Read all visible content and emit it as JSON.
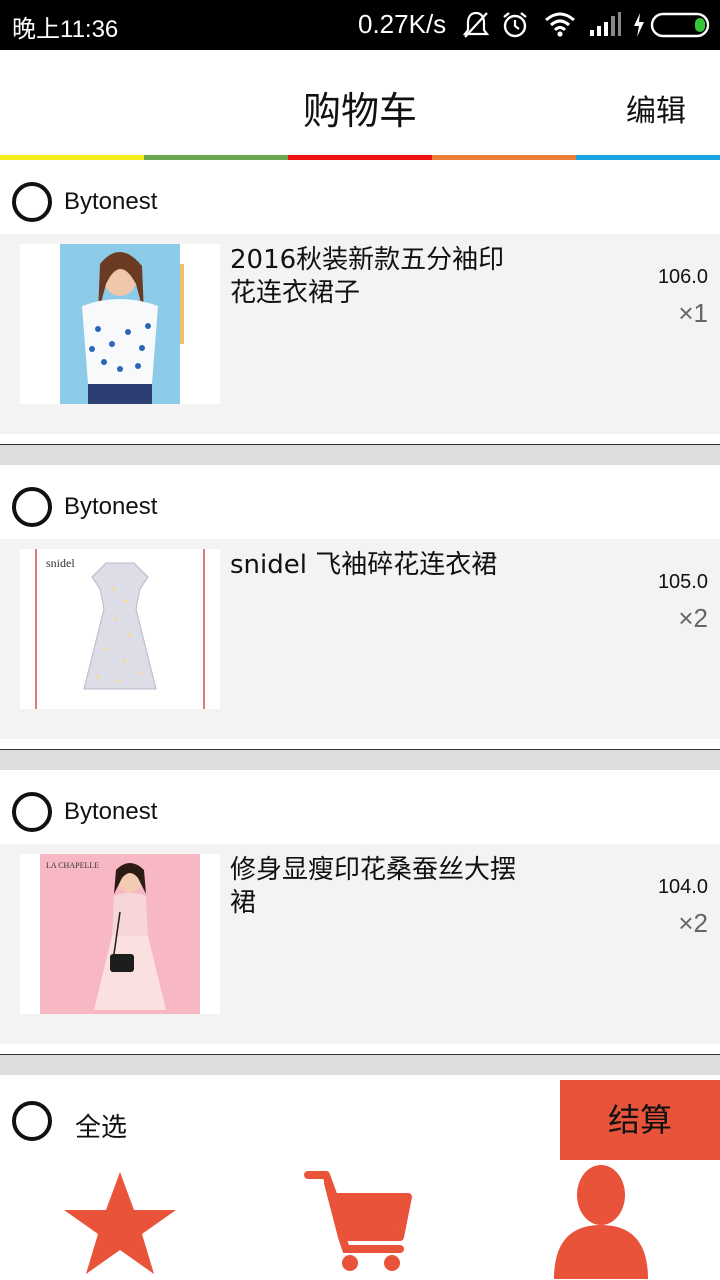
{
  "status": {
    "time": "晚上11:36",
    "speed": "0.27K/s"
  },
  "header": {
    "title": "购物车",
    "edit_label": "编辑"
  },
  "colors": {
    "bar": [
      "#f5ea1a",
      "#6aa84f",
      "#ee1111",
      "#ee7f3b",
      "#1aa4e6"
    ],
    "accent": "#e9533a"
  },
  "shops": [
    {
      "name": "Bytonest",
      "product": "2016秋装新款五分袖印花连衣裙子",
      "price": "106.0",
      "qty": "×1"
    },
    {
      "name": "Bytonest",
      "product": "snidel 飞袖碎花连衣裙",
      "price": "105.0",
      "qty": "×2"
    },
    {
      "name": "Bytonest",
      "product": "修身显瘦印花桑蚕丝大摆裙",
      "price": "104.0",
      "qty": "×2"
    }
  ],
  "footer": {
    "select_all": "全选",
    "checkout": "结算"
  },
  "tabs": [
    {
      "icon": "star-icon"
    },
    {
      "icon": "cart-icon"
    },
    {
      "icon": "user-icon"
    }
  ]
}
